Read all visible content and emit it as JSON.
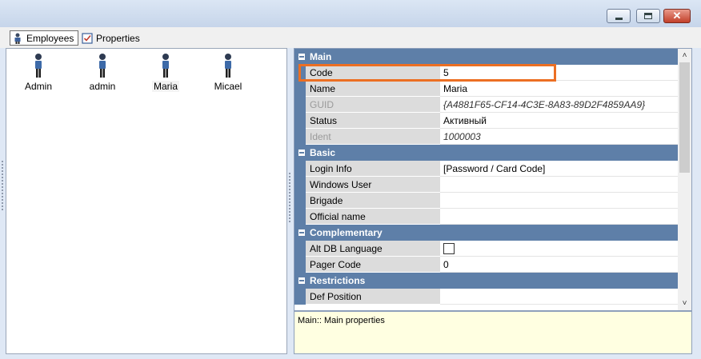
{
  "window": {
    "controls": {
      "minimize_icon": "minimize-icon",
      "maximize_icon": "maximize-icon",
      "close_glyph": "✕"
    }
  },
  "tabs": [
    {
      "label": "Employees",
      "icon": "employee-icon",
      "active": true
    },
    {
      "label": "Properties",
      "icon": "properties-icon",
      "active": false
    }
  ],
  "employees": [
    {
      "name": "Admin"
    },
    {
      "name": "admin"
    },
    {
      "name": "Maria",
      "selected": true
    },
    {
      "name": "Micael"
    }
  ],
  "property_grid": {
    "categories": [
      {
        "title": "Main",
        "properties": [
          {
            "name": "Code",
            "value": "5"
          },
          {
            "name": "Name",
            "value": "Maria"
          },
          {
            "name": "GUID",
            "value": "{A4881F65-CF14-4C3E-8A83-89D2F4859AA9}",
            "disabled": true
          },
          {
            "name": "Status",
            "value": "Активный"
          },
          {
            "name": "Ident",
            "value": "1000003",
            "disabled": true
          }
        ]
      },
      {
        "title": "Basic",
        "properties": [
          {
            "name": "Login Info",
            "value": "[Password / Card Code]"
          },
          {
            "name": "Windows User",
            "value": ""
          },
          {
            "name": "Brigade",
            "value": ""
          },
          {
            "name": "Official name",
            "value": ""
          }
        ]
      },
      {
        "title": "Complementary",
        "properties": [
          {
            "name": "Alt DB Language",
            "value": "",
            "checkbox": true,
            "checked": false
          },
          {
            "name": "Pager Code",
            "value": "0"
          }
        ]
      },
      {
        "title": "Restrictions",
        "properties": [
          {
            "name": "Def Position",
            "value": ""
          }
        ]
      }
    ],
    "scroll_up": "˄",
    "scroll_down": "˅"
  },
  "description": "Main:: Main properties",
  "colors": {
    "category_bg": "#5e7fa8",
    "highlight": "#ec6f23",
    "description_bg": "#ffffe1"
  }
}
